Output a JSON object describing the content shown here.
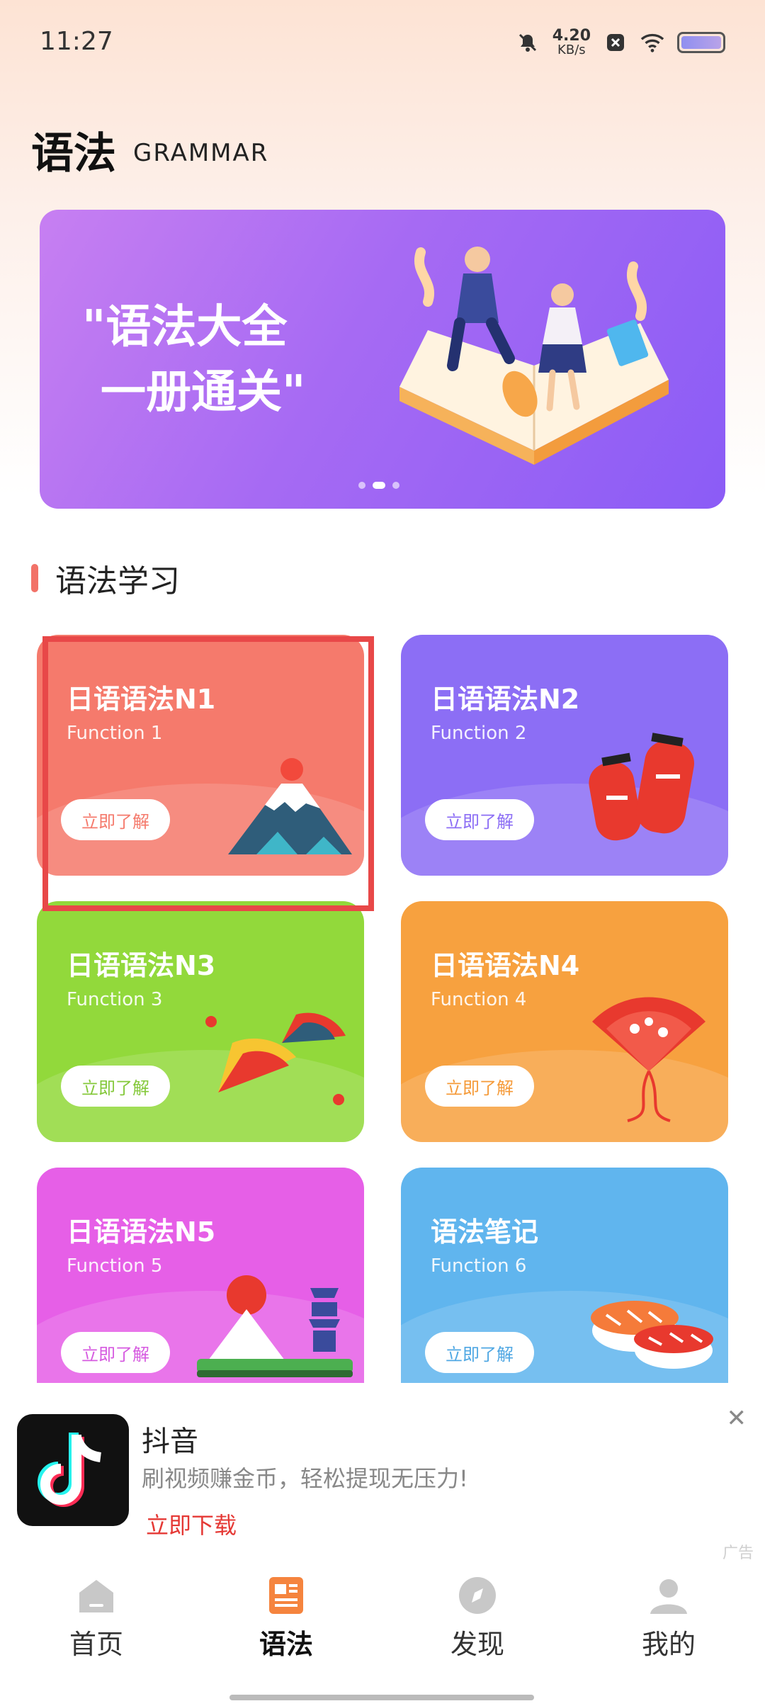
{
  "status_bar": {
    "time": "11:27",
    "net_speed_value": "4.20",
    "net_speed_unit": "KB/s"
  },
  "header": {
    "title": "语法",
    "subtitle": "GRAMMAR"
  },
  "banner": {
    "line1": "\"语法大全",
    "line2": "一册通关\"",
    "page_index": 2,
    "page_count": 3
  },
  "section": {
    "title": "语法学习",
    "accent_color": "#f27268"
  },
  "cards": [
    {
      "title": "日语语法N1",
      "subtitle": "Function 1",
      "button": "立即了解",
      "color": "#f57a6c",
      "icon": "mount-fuji-icon"
    },
    {
      "title": "日语语法N2",
      "subtitle": "Function 2",
      "button": "立即了解",
      "color": "#8c6ef5",
      "icon": "lanterns-icon"
    },
    {
      "title": "日语语法N3",
      "subtitle": "Function 3",
      "button": "立即了解",
      "color": "#92d93b",
      "icon": "folding-fans-icon"
    },
    {
      "title": "日语语法N4",
      "subtitle": "Function 4",
      "button": "立即了解",
      "color": "#f7a13f",
      "icon": "sakura-fan-icon"
    },
    {
      "title": "日语语法N5",
      "subtitle": "Function 5",
      "button": "立即了解",
      "color": "#e65fe7",
      "icon": "japan-landscape-icon"
    },
    {
      "title": "语法笔记",
      "subtitle": "Function 6",
      "button": "立即了解",
      "color": "#60b5ee",
      "icon": "sushi-icon"
    }
  ],
  "ad": {
    "app_name": "抖音",
    "description": "刷视频赚金币，轻松提现无压力!",
    "cta": "立即下载",
    "tag": "广告"
  },
  "bottom_nav": [
    {
      "label": "首页",
      "icon": "home-icon",
      "active": false
    },
    {
      "label": "语法",
      "icon": "book-icon",
      "active": true
    },
    {
      "label": "发现",
      "icon": "compass-icon",
      "active": false
    },
    {
      "label": "我的",
      "icon": "user-icon",
      "active": false
    }
  ],
  "colors": {
    "nav_active": "#f5843e",
    "nav_inactive": "#c8c8c8",
    "ad_cta": "#e53935"
  }
}
